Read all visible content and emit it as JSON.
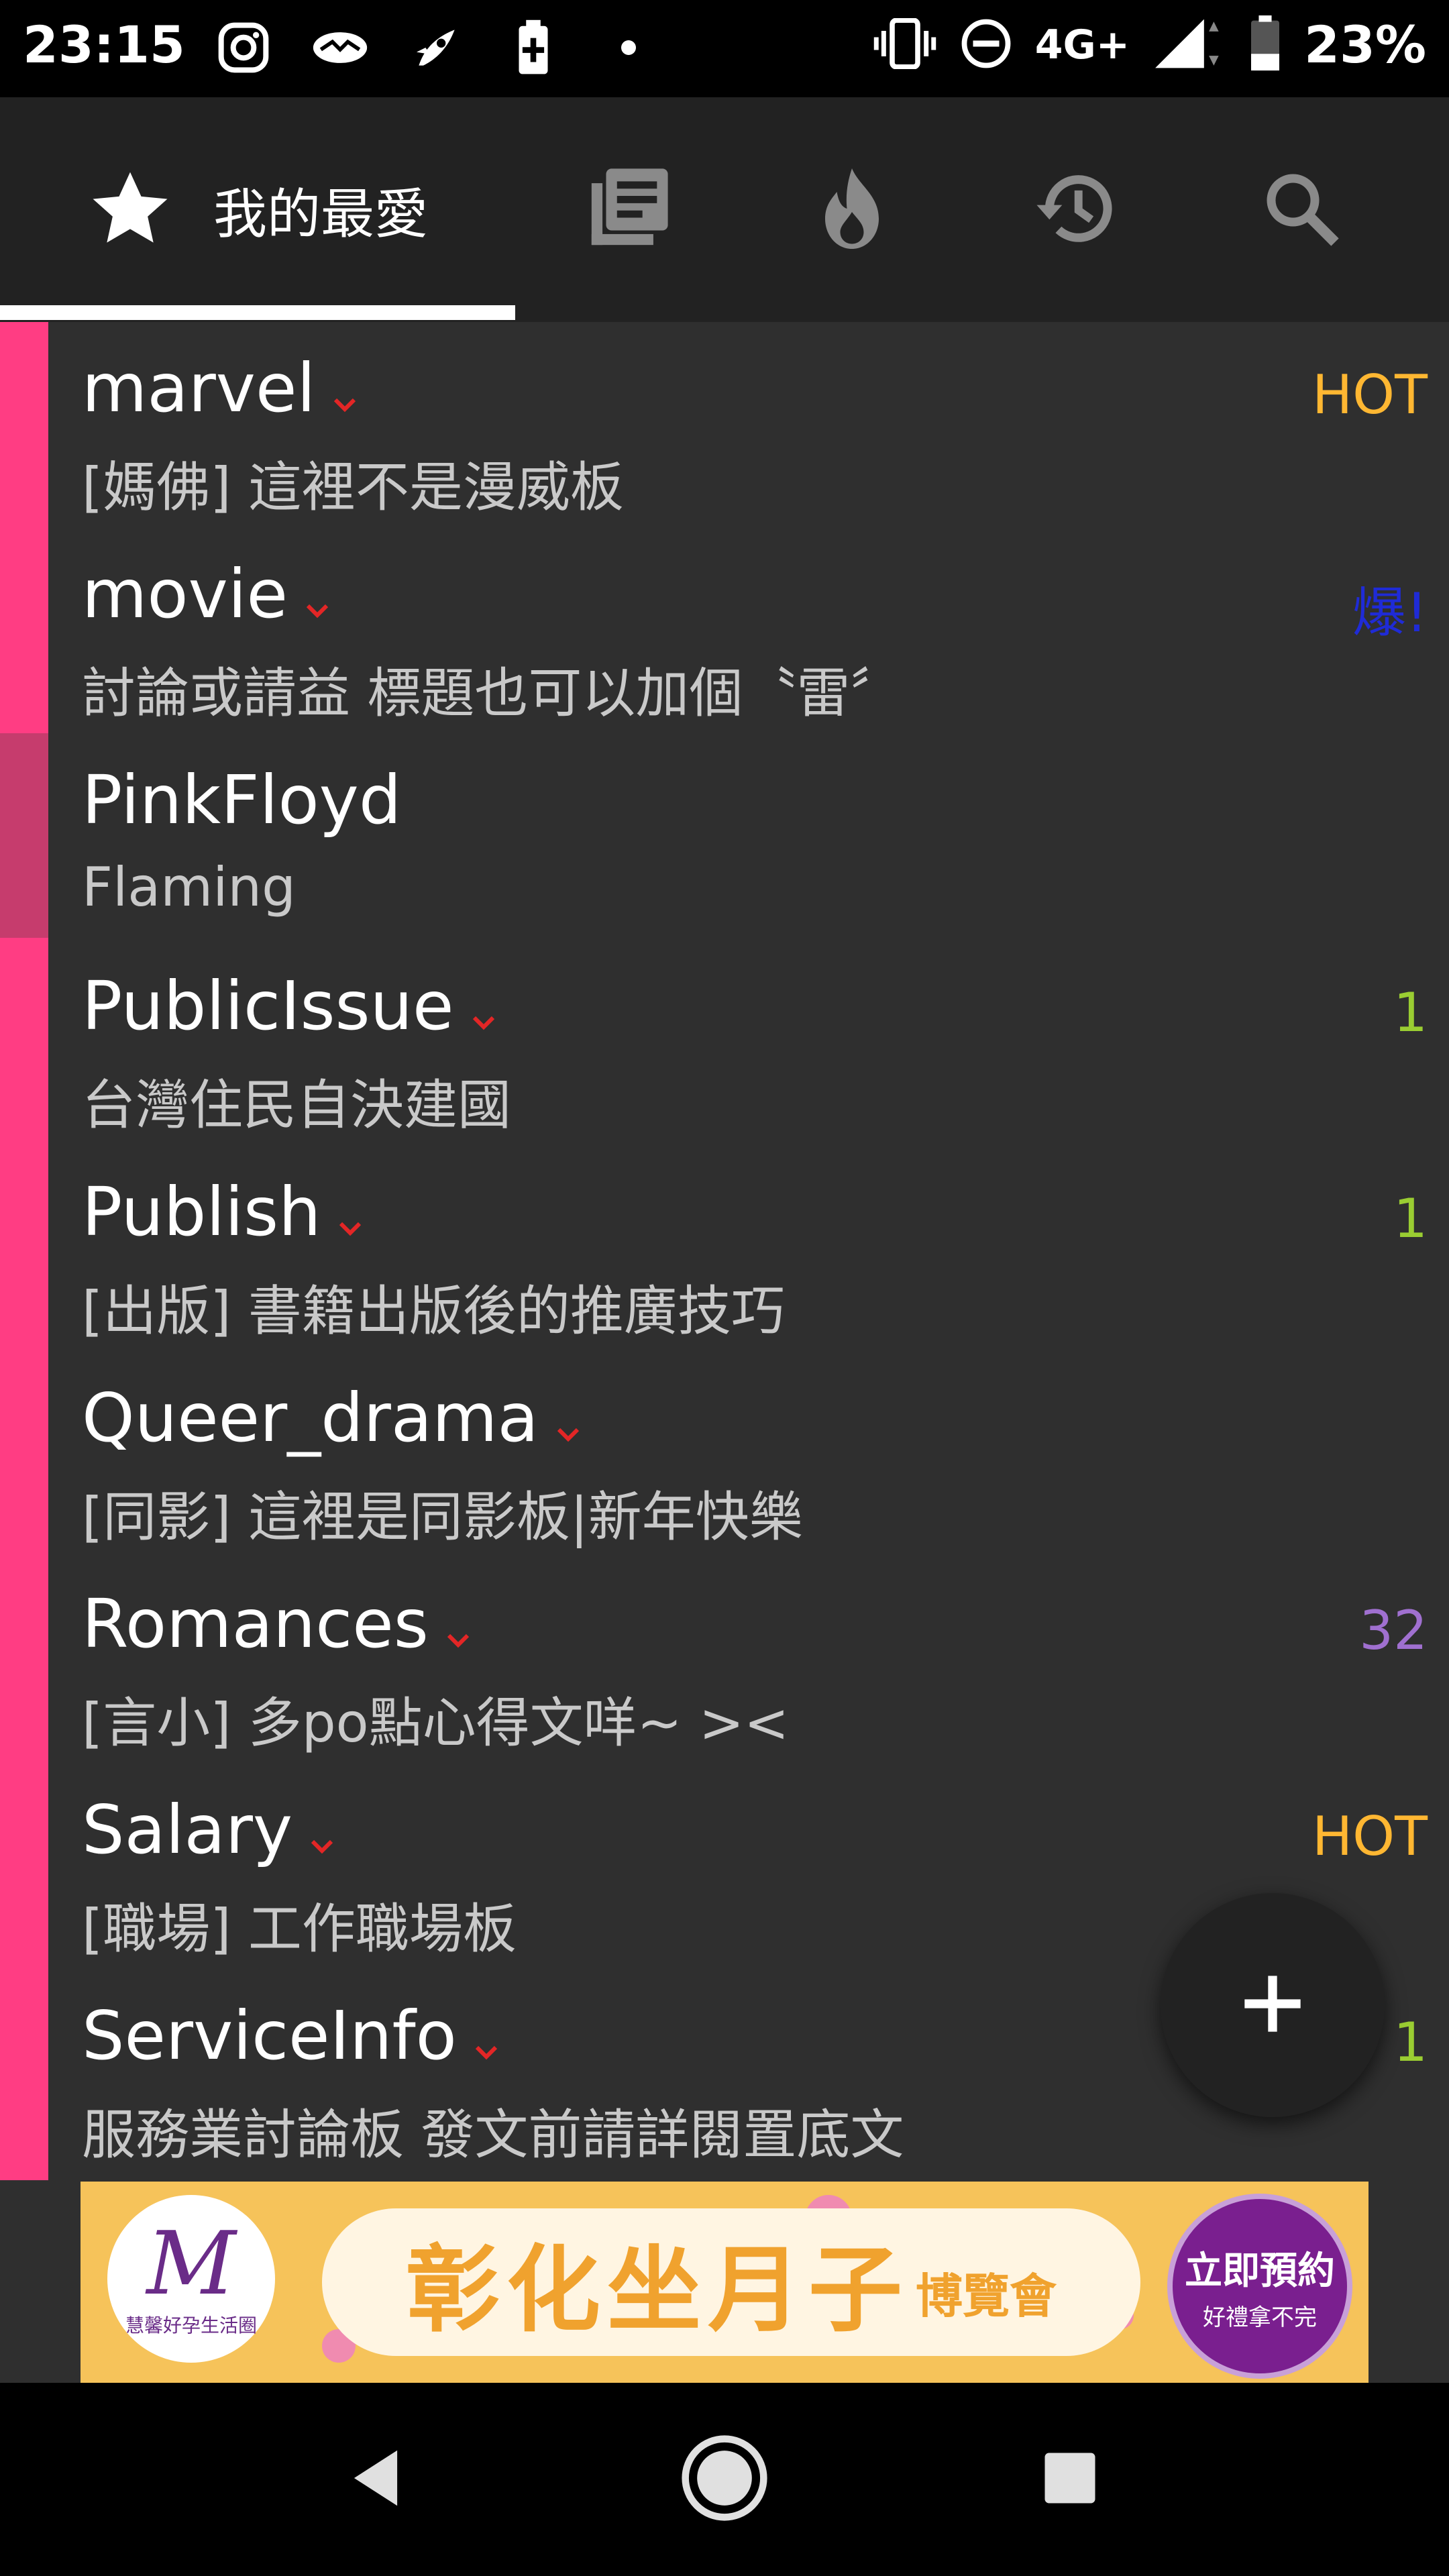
{
  "status_bar": {
    "time": "23:15",
    "network": "4G+",
    "battery": "23%",
    "icons_left": [
      "instagram-icon",
      "messenger-icon",
      "rocket-icon",
      "battery-saver-icon",
      "dot-icon"
    ],
    "icons_right": [
      "vibrate-icon",
      "dnd-icon",
      "signal-icon",
      "battery-icon"
    ]
  },
  "tabs": [
    {
      "id": "favorites",
      "label": "我的最愛",
      "icon": "star-icon"
    },
    {
      "id": "boards",
      "icon": "boards-icon"
    },
    {
      "id": "hot",
      "icon": "fire-icon"
    },
    {
      "id": "history",
      "icon": "history-icon"
    },
    {
      "id": "search",
      "icon": "search-icon"
    }
  ],
  "boards": [
    {
      "name": "marvel",
      "desc": "[媽佛] 這裡不是漫威板",
      "badge": "HOT",
      "badge_color": "#ffb732",
      "chevron": true
    },
    {
      "name": "movie",
      "desc": "討論或請益 標題也可以加個〝雷〞",
      "badge": "爆!",
      "badge_color": "#1f2bd6",
      "chevron": true
    },
    {
      "name": "PinkFloyd",
      "desc": "Flaming",
      "badge": "",
      "badge_color": "#ffffff",
      "chevron": false
    },
    {
      "name": "PublicIssue",
      "desc": "台灣住民自決建國",
      "badge": "1",
      "badge_color": "#9acd32",
      "chevron": true
    },
    {
      "name": "Publish",
      "desc": "[出版] 書籍出版後的推廣技巧",
      "badge": "1",
      "badge_color": "#9acd32",
      "chevron": true
    },
    {
      "name": "Queer_drama",
      "desc": "[同影] 這裡是同影板|新年快樂",
      "badge": "",
      "badge_color": "#ffffff",
      "chevron": true
    },
    {
      "name": "Romances",
      "desc": "[言小] 多po點心得文咩~ ><",
      "badge": "32",
      "badge_color": "#a070d0",
      "chevron": true
    },
    {
      "name": "Salary",
      "desc": "[職場] 工作職場板",
      "badge": "HOT",
      "badge_color": "#ffb732",
      "chevron": true
    },
    {
      "name": "ServiceInfo",
      "desc": "服務業討論板 發文前請詳閱置底文",
      "badge": "1",
      "badge_color": "#9acd32",
      "chevron": true
    }
  ],
  "fab": {
    "icon": "plus-icon"
  },
  "ad": {
    "logo_letter": "M",
    "logo_caption": "慧馨好孕生活圈",
    "headline": "彰化坐月子",
    "headline_suffix": "博覽會",
    "cta_line1": "立即預約",
    "cta_line2": "好禮拿不完"
  },
  "nav": [
    "back-icon",
    "home-icon",
    "recents-icon"
  ]
}
